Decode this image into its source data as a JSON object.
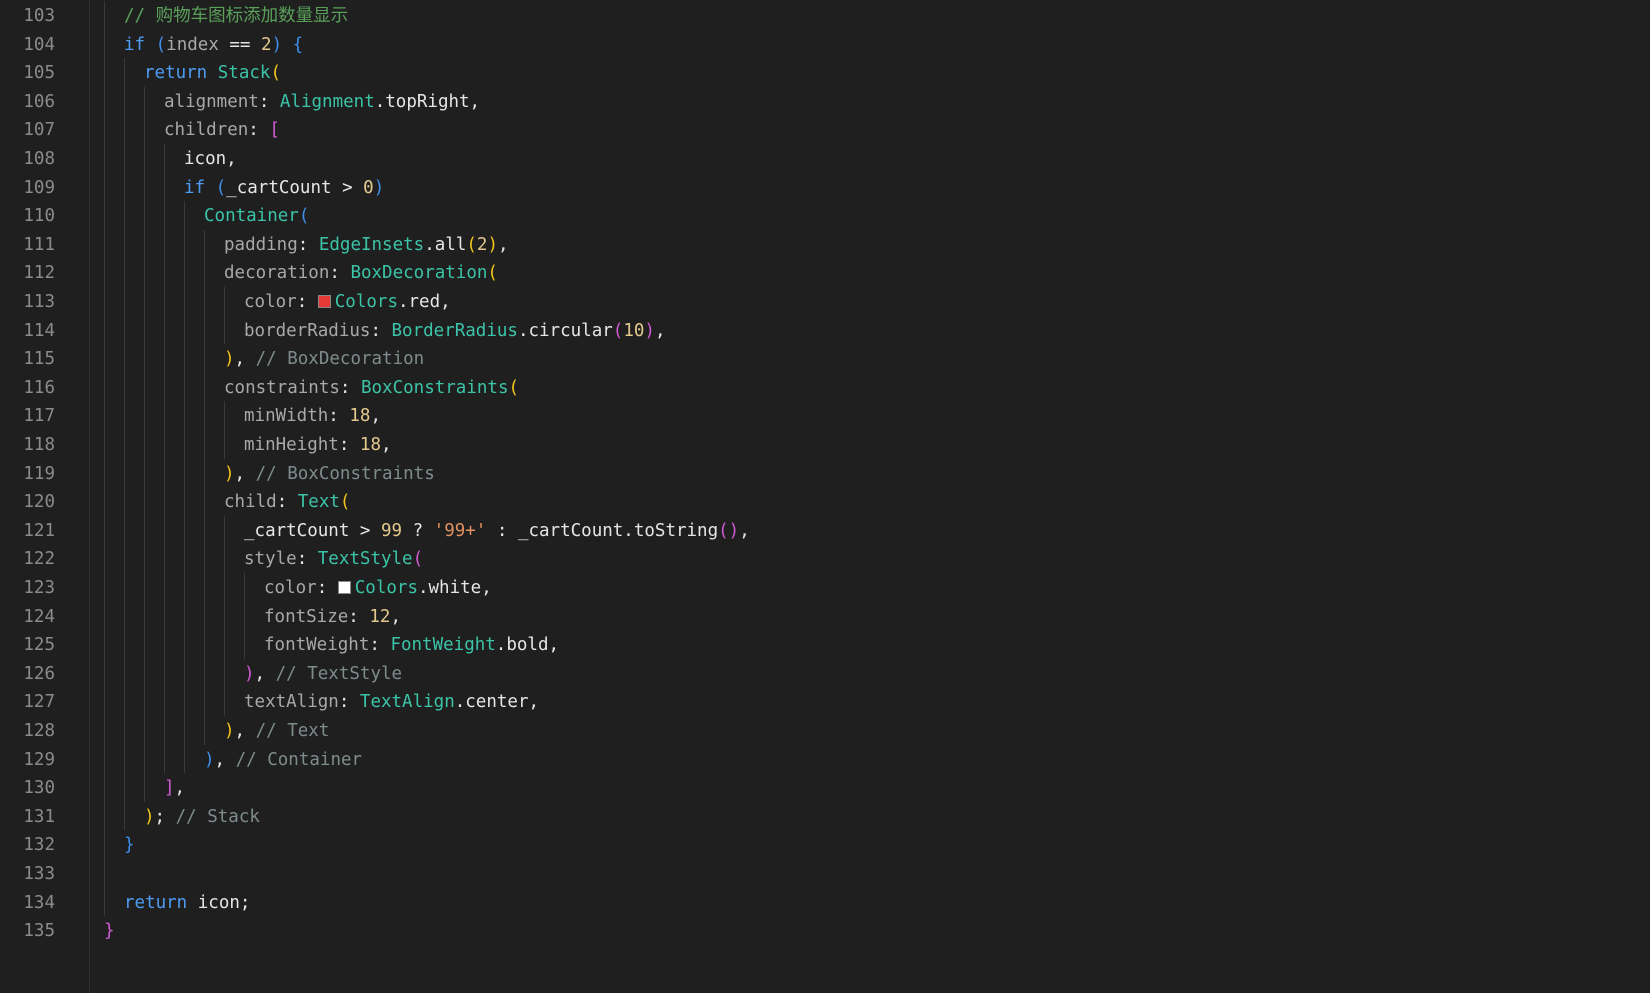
{
  "editor": {
    "lines": [
      {
        "n": "103",
        "indent": 1,
        "tokens": [
          {
            "t": "// 购物车图标添加数量显示",
            "c": "cm-cn"
          }
        ]
      },
      {
        "n": "104",
        "indent": 1,
        "tokens": [
          {
            "t": "if",
            "c": "kw"
          },
          {
            "t": " "
          },
          {
            "t": "(",
            "c": "p3"
          },
          {
            "t": "index",
            "c": "prop"
          },
          {
            "t": " == "
          },
          {
            "t": "2",
            "c": "num"
          },
          {
            "t": ")",
            "c": "p3"
          },
          {
            "t": " "
          },
          {
            "t": "{",
            "c": "p3"
          }
        ]
      },
      {
        "n": "105",
        "indent": 2,
        "tokens": [
          {
            "t": "return",
            "c": "kw"
          },
          {
            "t": " "
          },
          {
            "t": "Stack",
            "c": "cls"
          },
          {
            "t": "(",
            "c": "p1"
          }
        ]
      },
      {
        "n": "106",
        "indent": 3,
        "tokens": [
          {
            "t": "alignment",
            "c": "prop"
          },
          {
            "t": ": "
          },
          {
            "t": "Alignment",
            "c": "cls"
          },
          {
            "t": ".topRight,"
          }
        ]
      },
      {
        "n": "107",
        "indent": 3,
        "tokens": [
          {
            "t": "children",
            "c": "prop"
          },
          {
            "t": ": "
          },
          {
            "t": "[",
            "c": "p2"
          }
        ]
      },
      {
        "n": "108",
        "indent": 4,
        "tokens": [
          {
            "t": "icon,"
          }
        ]
      },
      {
        "n": "109",
        "indent": 4,
        "tokens": [
          {
            "t": "if",
            "c": "kw"
          },
          {
            "t": " "
          },
          {
            "t": "(",
            "c": "p3"
          },
          {
            "t": "_cartCount > "
          },
          {
            "t": "0",
            "c": "num"
          },
          {
            "t": ")",
            "c": "p3"
          }
        ]
      },
      {
        "n": "110",
        "indent": 5,
        "tokens": [
          {
            "t": "Container",
            "c": "cls"
          },
          {
            "t": "(",
            "c": "p3"
          }
        ]
      },
      {
        "n": "111",
        "indent": 6,
        "tokens": [
          {
            "t": "padding",
            "c": "prop"
          },
          {
            "t": ": "
          },
          {
            "t": "EdgeInsets",
            "c": "cls"
          },
          {
            "t": ".all"
          },
          {
            "t": "(",
            "c": "p1"
          },
          {
            "t": "2",
            "c": "num"
          },
          {
            "t": ")",
            "c": "p1"
          },
          {
            "t": ","
          }
        ]
      },
      {
        "n": "112",
        "indent": 6,
        "tokens": [
          {
            "t": "decoration",
            "c": "prop"
          },
          {
            "t": ": "
          },
          {
            "t": "BoxDecoration",
            "c": "cls"
          },
          {
            "t": "(",
            "c": "p1"
          }
        ]
      },
      {
        "n": "113",
        "indent": 7,
        "tokens": [
          {
            "t": "color",
            "c": "prop"
          },
          {
            "t": ": "
          },
          {
            "swatch": "#e53935"
          },
          {
            "t": "Colors",
            "c": "cls"
          },
          {
            "t": ".red,"
          }
        ]
      },
      {
        "n": "114",
        "indent": 7,
        "tokens": [
          {
            "t": "borderRadius",
            "c": "prop"
          },
          {
            "t": ": "
          },
          {
            "t": "BorderRadius",
            "c": "cls"
          },
          {
            "t": ".circular"
          },
          {
            "t": "(",
            "c": "p2"
          },
          {
            "t": "10",
            "c": "num"
          },
          {
            "t": ")",
            "c": "p2"
          },
          {
            "t": ","
          }
        ]
      },
      {
        "n": "115",
        "indent": 6,
        "tokens": [
          {
            "t": ")",
            "c": "p1"
          },
          {
            "t": ", "
          },
          {
            "t": "// BoxDecoration",
            "c": "cm"
          }
        ]
      },
      {
        "n": "116",
        "indent": 6,
        "tokens": [
          {
            "t": "constraints",
            "c": "prop"
          },
          {
            "t": ": "
          },
          {
            "t": "BoxConstraints",
            "c": "cls"
          },
          {
            "t": "(",
            "c": "p1"
          }
        ]
      },
      {
        "n": "117",
        "indent": 7,
        "tokens": [
          {
            "t": "minWidth",
            "c": "prop"
          },
          {
            "t": ": "
          },
          {
            "t": "18",
            "c": "num"
          },
          {
            "t": ","
          }
        ]
      },
      {
        "n": "118",
        "indent": 7,
        "tokens": [
          {
            "t": "minHeight",
            "c": "prop"
          },
          {
            "t": ": "
          },
          {
            "t": "18",
            "c": "num"
          },
          {
            "t": ","
          }
        ]
      },
      {
        "n": "119",
        "indent": 6,
        "tokens": [
          {
            "t": ")",
            "c": "p1"
          },
          {
            "t": ", "
          },
          {
            "t": "// BoxConstraints",
            "c": "cm"
          }
        ]
      },
      {
        "n": "120",
        "indent": 6,
        "tokens": [
          {
            "t": "child",
            "c": "prop"
          },
          {
            "t": ": "
          },
          {
            "t": "Text",
            "c": "cls"
          },
          {
            "t": "(",
            "c": "p1"
          }
        ]
      },
      {
        "n": "121",
        "indent": 7,
        "tokens": [
          {
            "t": "_cartCount > "
          },
          {
            "t": "99",
            "c": "num"
          },
          {
            "t": " ? "
          },
          {
            "t": "'99+'",
            "c": "str"
          },
          {
            "t": " : _cartCount.toString"
          },
          {
            "t": "()",
            "c": "p2"
          },
          {
            "t": ","
          }
        ]
      },
      {
        "n": "122",
        "indent": 7,
        "tokens": [
          {
            "t": "style",
            "c": "prop"
          },
          {
            "t": ": "
          },
          {
            "t": "TextStyle",
            "c": "cls"
          },
          {
            "t": "(",
            "c": "p2"
          }
        ]
      },
      {
        "n": "123",
        "indent": 8,
        "tokens": [
          {
            "t": "color",
            "c": "prop"
          },
          {
            "t": ": "
          },
          {
            "swatch": "#ffffff"
          },
          {
            "t": "Colors",
            "c": "cls"
          },
          {
            "t": ".white,"
          }
        ]
      },
      {
        "n": "124",
        "indent": 8,
        "tokens": [
          {
            "t": "fontSize",
            "c": "prop"
          },
          {
            "t": ": "
          },
          {
            "t": "12",
            "c": "num"
          },
          {
            "t": ","
          }
        ]
      },
      {
        "n": "125",
        "indent": 8,
        "tokens": [
          {
            "t": "fontWeight",
            "c": "prop"
          },
          {
            "t": ": "
          },
          {
            "t": "FontWeight",
            "c": "cls"
          },
          {
            "t": ".bold,"
          }
        ]
      },
      {
        "n": "126",
        "indent": 7,
        "tokens": [
          {
            "t": ")",
            "c": "p2"
          },
          {
            "t": ", "
          },
          {
            "t": "// TextStyle",
            "c": "cm"
          }
        ]
      },
      {
        "n": "127",
        "indent": 7,
        "tokens": [
          {
            "t": "textAlign",
            "c": "prop"
          },
          {
            "t": ": "
          },
          {
            "t": "TextAlign",
            "c": "cls"
          },
          {
            "t": ".center,"
          }
        ]
      },
      {
        "n": "128",
        "indent": 6,
        "tokens": [
          {
            "t": ")",
            "c": "p1"
          },
          {
            "t": ", "
          },
          {
            "t": "// Text",
            "c": "cm"
          }
        ]
      },
      {
        "n": "129",
        "indent": 5,
        "tokens": [
          {
            "t": ")",
            "c": "p3"
          },
          {
            "t": ", "
          },
          {
            "t": "// Container",
            "c": "cm"
          }
        ]
      },
      {
        "n": "130",
        "indent": 3,
        "tokens": [
          {
            "t": "]",
            "c": "p2"
          },
          {
            "t": ","
          }
        ]
      },
      {
        "n": "131",
        "indent": 2,
        "tokens": [
          {
            "t": ")",
            "c": "p1"
          },
          {
            "t": "; "
          },
          {
            "t": "// Stack",
            "c": "cm"
          }
        ]
      },
      {
        "n": "132",
        "indent": 1,
        "tokens": [
          {
            "t": "}",
            "c": "p3"
          }
        ]
      },
      {
        "n": "133",
        "indent": 1,
        "tokens": []
      },
      {
        "n": "134",
        "indent": 1,
        "tokens": [
          {
            "t": "return",
            "c": "kw"
          },
          {
            "t": " icon;"
          }
        ]
      },
      {
        "n": "135",
        "indent": 0,
        "tokens": [
          {
            "t": "}",
            "c": "p2"
          }
        ]
      }
    ]
  }
}
